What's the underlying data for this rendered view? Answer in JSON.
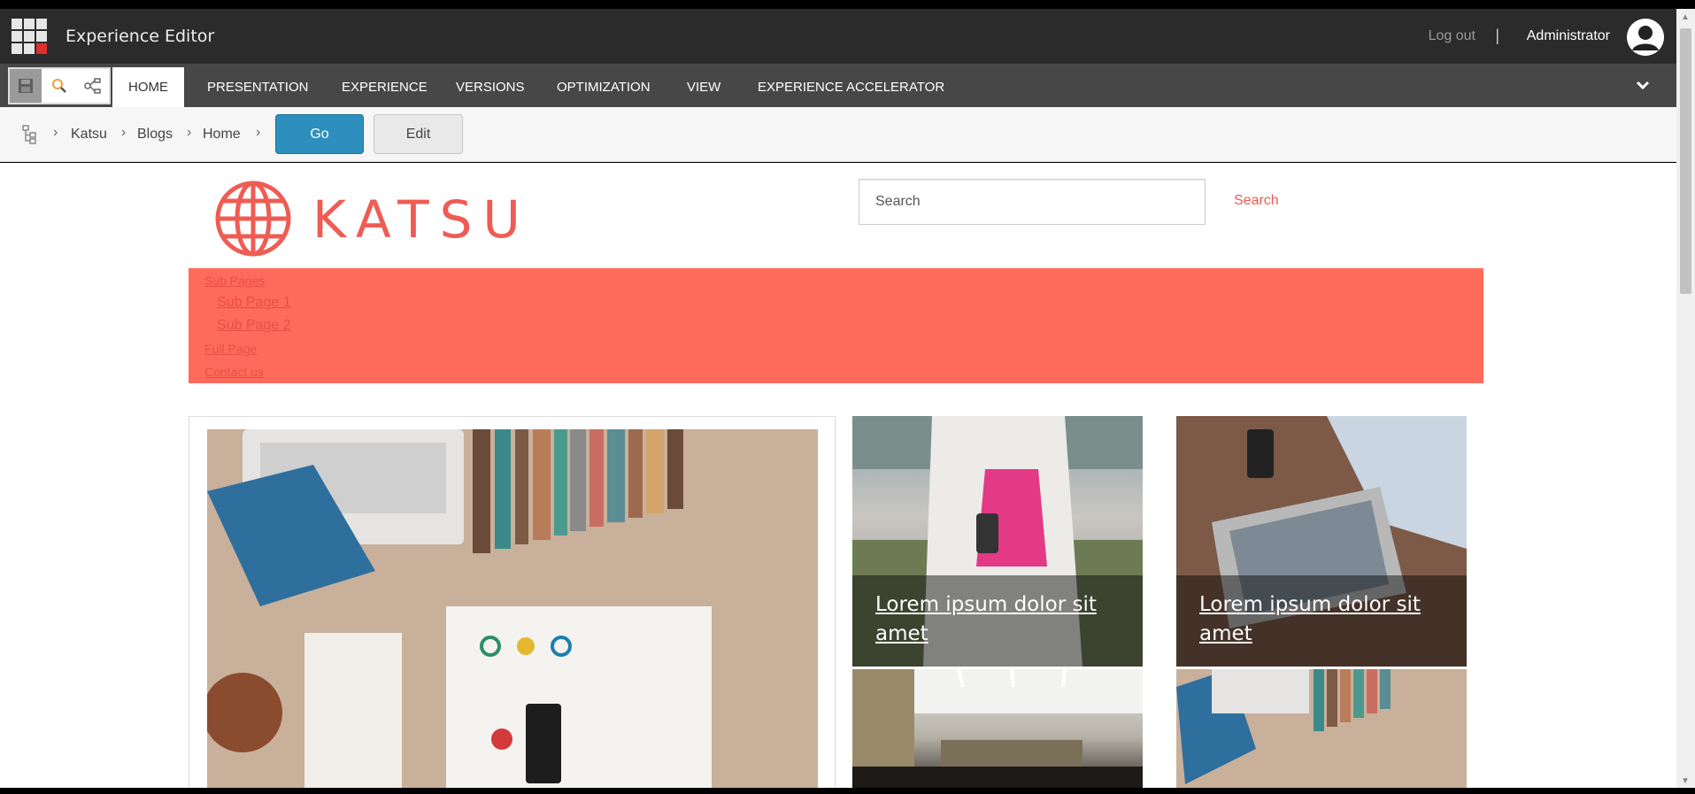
{
  "app": {
    "title": "Experience Editor"
  },
  "user": {
    "logout_label": "Log out",
    "separator": "|",
    "name": "Administrator"
  },
  "ribbon": {
    "tabs": [
      {
        "label": "HOME",
        "active": true
      },
      {
        "label": "PRESENTATION"
      },
      {
        "label": "EXPERIENCE"
      },
      {
        "label": "VERSIONS"
      },
      {
        "label": "OPTIMIZATION"
      },
      {
        "label": "VIEW"
      },
      {
        "label": "EXPERIENCE ACCELERATOR"
      }
    ]
  },
  "breadcrumb": {
    "items": [
      "Katsu",
      "Blogs",
      "Home"
    ],
    "go_label": "Go",
    "edit_label": "Edit"
  },
  "site": {
    "logo_text": "KATSU",
    "search_placeholder": "Search",
    "search_button": "Search",
    "brand_color": "#ff6b5b",
    "nav": {
      "items": [
        "Sub Pages",
        "Sub Page 1",
        "Sub Page 2",
        "Full Page",
        "Contact us"
      ]
    },
    "tiles": [
      {
        "caption": "Lorem ipsum dolor sit amet"
      },
      {
        "caption": "Lorem ipsum dolor sit amet"
      }
    ]
  },
  "colors": {
    "accent_blue": "#2d8fbe",
    "dark_bar": "#2b2b2b",
    "ribbon_bar": "#474747"
  }
}
